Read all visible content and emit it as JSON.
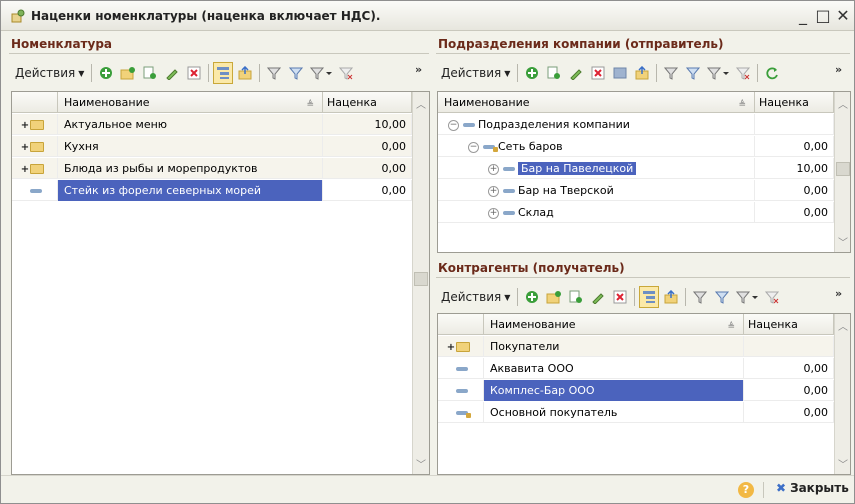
{
  "window": {
    "title": "Наценки номенклатуры (наценка включает НДС).",
    "minimize": "_",
    "maximize": "□",
    "close": "✕"
  },
  "left": {
    "title": "Номенклатура",
    "actions": "Действия",
    "more": "»",
    "columns": {
      "name": "Наименование",
      "markup": "Наценка"
    },
    "rows": [
      {
        "name": "Актуальное меню",
        "markup": "10,00"
      },
      {
        "name": "Кухня",
        "markup": "0,00"
      },
      {
        "name": "Блюда из рыбы и морепродуктов",
        "markup": "0,00"
      },
      {
        "name": "Стейк из форели северных морей",
        "markup": "0,00"
      }
    ]
  },
  "top_right": {
    "title": "Подразделения компании (отправитель)",
    "actions": "Действия",
    "more": "»",
    "columns": {
      "name": "Наименование",
      "markup": "Наценка"
    },
    "rows": [
      {
        "name": "Подразделения компании",
        "markup": ""
      },
      {
        "name": "Сеть баров",
        "markup": "0,00"
      },
      {
        "name": "Бар на Павелецкой",
        "markup": "10,00"
      },
      {
        "name": "Бар на Тверской",
        "markup": "0,00"
      },
      {
        "name": "Склад",
        "markup": "0,00"
      }
    ]
  },
  "bottom_right": {
    "title": "Контрагенты (получатель)",
    "actions": "Действия",
    "more": "»",
    "columns": {
      "name": "Наименование",
      "markup": "Наценка"
    },
    "rows": [
      {
        "name": "Покупатели",
        "markup": ""
      },
      {
        "name": "Аквавита ООО",
        "markup": "0,00"
      },
      {
        "name": "Комплес-Бар ООО",
        "markup": "0,00"
      },
      {
        "name": "Основной покупатель",
        "markup": "0,00"
      }
    ]
  },
  "footer": {
    "help": "?",
    "close_label": "Закрыть"
  },
  "colors": {
    "selection": "#4b63bd",
    "section_title": "#6b2a1a",
    "pressed_button": "#fbe9a8",
    "folder": "#f1d27a"
  },
  "icons": [
    "add-icon",
    "add-folder-icon",
    "copy-icon",
    "edit-icon",
    "delete-icon",
    "hierarchy-icon",
    "up-level-icon",
    "filter-icon",
    "filter-by-value-icon",
    "filter-menu-icon",
    "clear-filter-icon",
    "refresh-icon"
  ]
}
